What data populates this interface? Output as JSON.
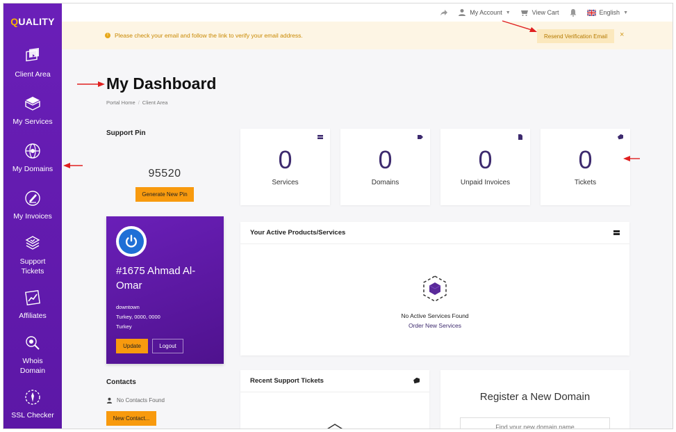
{
  "brand": {
    "logo_q": "Q",
    "logo_rest": "UALITY"
  },
  "sidebar": {
    "items": [
      {
        "label": "Client Area",
        "icon": "client-area-icon"
      },
      {
        "label": "My Services",
        "icon": "services-box-icon"
      },
      {
        "label": "My Domains",
        "icon": "globe-icon"
      },
      {
        "label": "My Invoices",
        "icon": "invoice-icon"
      },
      {
        "label": "Support Tickets",
        "icon": "support-icon"
      },
      {
        "label": "Affiliates",
        "icon": "affiliates-chart-icon"
      },
      {
        "label": "Whois Domain",
        "icon": "whois-icon"
      },
      {
        "label": "SSL Checker",
        "icon": "ssl-icon"
      }
    ]
  },
  "topbar": {
    "account": "My Account",
    "cart": "View Cart",
    "language": "English"
  },
  "alert": {
    "message": "Please check your email and follow the link to verify your email address.",
    "resend_label": "Resend Verification Email",
    "close": "×"
  },
  "page": {
    "title": "My Dashboard",
    "breadcrumb": [
      "Portal Home",
      "Client Area"
    ]
  },
  "support_pin": {
    "label": "Support Pin",
    "value": "95520",
    "button": "Generate New Pin"
  },
  "stats": [
    {
      "value": "0",
      "label": "Services"
    },
    {
      "value": "0",
      "label": "Domains"
    },
    {
      "value": "0",
      "label": "Unpaid Invoices"
    },
    {
      "value": "0",
      "label": "Tickets"
    }
  ],
  "profile": {
    "name": "#1675 Ahmad Al-Omar",
    "address_lines": [
      "downtown",
      "Turkey, 0000, 0000",
      "Turkey"
    ],
    "update_label": "Update",
    "logout_label": "Logout"
  },
  "active_products": {
    "title": "Your Active Products/Services",
    "empty_text": "No Active Services Found",
    "order_link": "Order New Services"
  },
  "contacts": {
    "title": "Contacts",
    "empty_text": "No Contacts Found",
    "button": "New Contact..."
  },
  "recent_tickets": {
    "title": "Recent Support Tickets"
  },
  "register_domain": {
    "title": "Register a New Domain",
    "placeholder": "Find your new domain name"
  },
  "colors": {
    "sidebar": "#6a1fb8",
    "accent_orange": "#f89a0e",
    "stat_number": "#3d2a6e",
    "alert_bg": "#fdf5e4",
    "annotation_arrow": "#e02020"
  }
}
